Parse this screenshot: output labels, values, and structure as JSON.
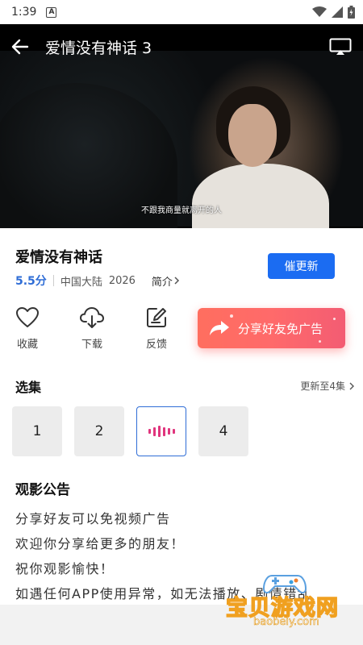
{
  "status_bar": {
    "time": "1:39",
    "badge": "A"
  },
  "video": {
    "title": "爱情没有神话 3",
    "subtitle": "不跟我商量就离开的人"
  },
  "info": {
    "title": "爱情没有神话",
    "score": "5.5分",
    "region": "中国大陆",
    "year": "2026",
    "intro_label": "简介",
    "urge_button": "催更新"
  },
  "actions": {
    "favorite": "收藏",
    "download": "下载",
    "feedback": "反馈",
    "share": "分享好友免广告"
  },
  "episodes": {
    "heading": "选集",
    "update_info": "更新至4集",
    "items": [
      "1",
      "2",
      "",
      "4"
    ]
  },
  "notice": {
    "title": "观影公告",
    "lines": [
      "分享好友可以免视频广告",
      "欢迎你分享给更多的朋友！",
      "祝你观影愉快！",
      "如遇任何APP使用异常，如无法播放、剧情错乱"
    ]
  },
  "watermark": {
    "text": "宝贝游戏网",
    "url": "baobeiy.com"
  },
  "colors": {
    "accent": "#1b6cf2",
    "share_gradient": "#ff6a6a",
    "playing": "#e0357d"
  }
}
